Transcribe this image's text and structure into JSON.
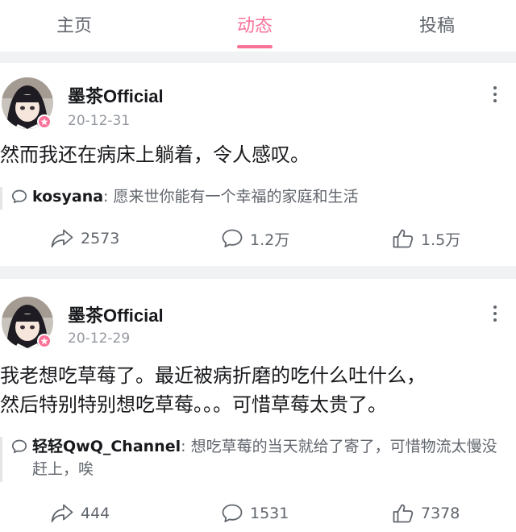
{
  "tabs": [
    {
      "label": "主页",
      "active": false
    },
    {
      "label": "动态",
      "active": true
    },
    {
      "label": "投稿",
      "active": false
    }
  ],
  "accent_color": "#fb7299",
  "posts": [
    {
      "username": "墨茶Official",
      "date": "20-12-31",
      "text_lines": [
        "然而我还在病床上躺着，令人感叹。"
      ],
      "comment": {
        "user": "kosyana",
        "sep": ":",
        "text": "愿来世你能有一个幸福的家庭和生活"
      },
      "share": "2573",
      "comments": "1.2万",
      "likes": "1.5万"
    },
    {
      "username": "墨茶Official",
      "date": "20-12-29",
      "text_lines": [
        "我老想吃草莓了。最近被病折磨的吃什么吐什么，",
        "然后特别特别想吃草莓。。。可惜草莓太贵了。"
      ],
      "comment": {
        "user": "轻轻QwQ_Channel",
        "sep": ":",
        "text": "想吃草莓的当天就给了寄了，可惜物流太慢没赶上，唉"
      },
      "share": "444",
      "comments": "1531",
      "likes": "7378"
    }
  ]
}
